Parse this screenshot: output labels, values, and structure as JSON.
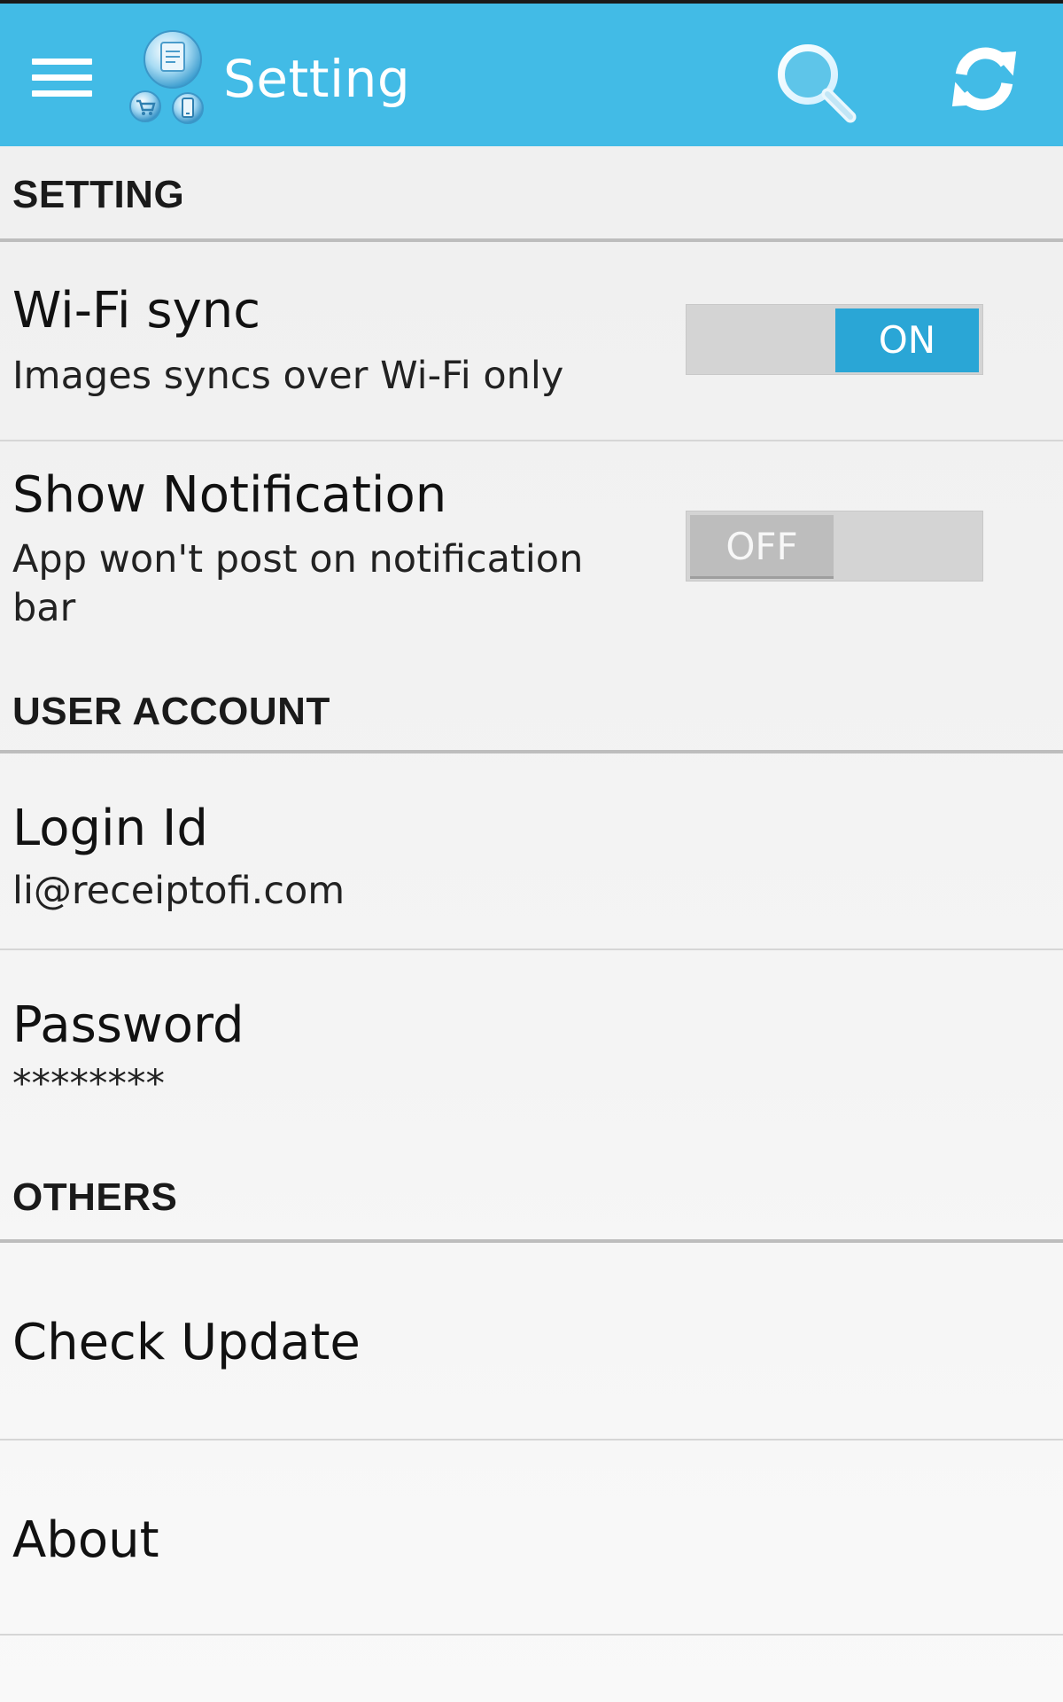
{
  "action_bar": {
    "title": "Setting",
    "color": "#42bbe6",
    "icons": [
      "menu-icon",
      "app-logo-icon",
      "search-icon",
      "refresh-icon"
    ]
  },
  "sections": {
    "setting": {
      "label": "SETTING"
    },
    "user_account": {
      "label": "USER ACCOUNT"
    },
    "others": {
      "label": "OTHERS"
    }
  },
  "wifi_sync": {
    "title": "Wi-Fi sync",
    "summary": "Images syncs over Wi-Fi only",
    "state": "ON",
    "enabled": true
  },
  "notification": {
    "title": "Show Notification",
    "summary": "App won't post on notification bar",
    "state": "OFF",
    "enabled": false
  },
  "login": {
    "title": "Login Id",
    "value": "li@receiptofi.com"
  },
  "password": {
    "title": "Password",
    "value": "********"
  },
  "check_update": {
    "title": "Check Update"
  },
  "about": {
    "title": "About"
  },
  "colors": {
    "toggle_on": "#2aa6d6",
    "toggle_off": "#bdbdbd",
    "background": "#f0f0f0"
  }
}
